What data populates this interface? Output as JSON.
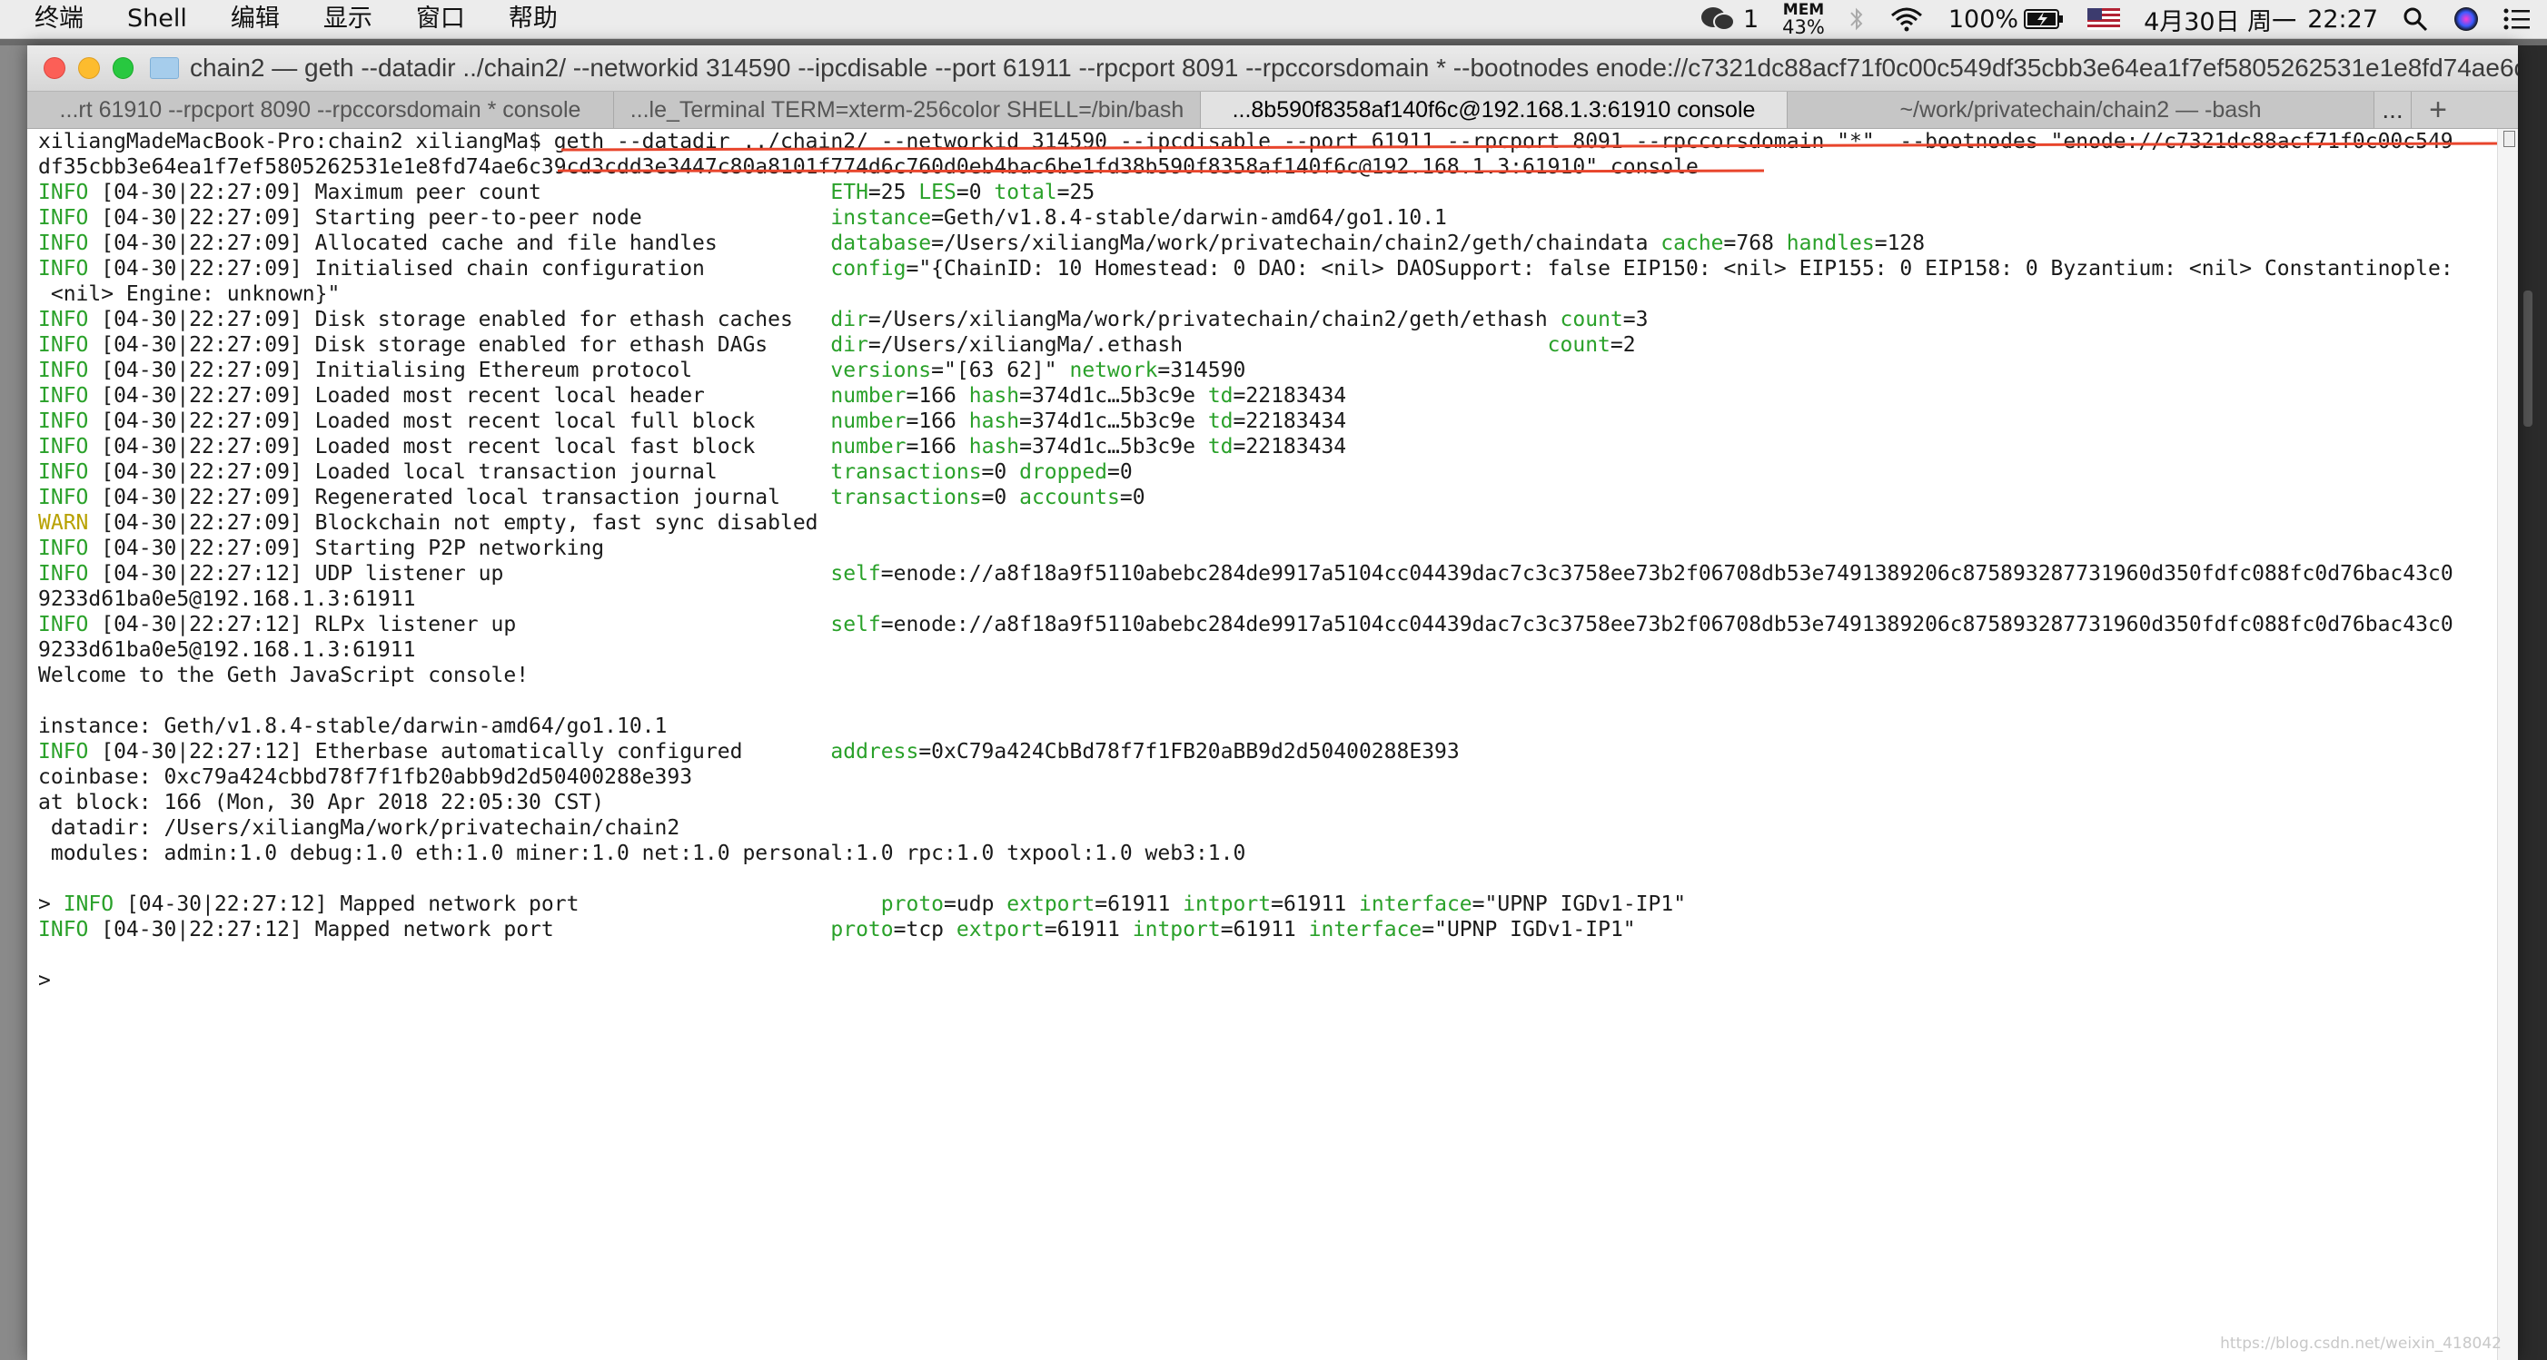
{
  "menubar": {
    "items": [
      "终端",
      "Shell",
      "编辑",
      "显示",
      "窗口",
      "帮助"
    ],
    "status": {
      "wechat_count": "1",
      "mem_label": "MEM",
      "mem_value": "43%",
      "battery": "100%",
      "date": "4月30日 周一",
      "time": "22:27"
    }
  },
  "window": {
    "title": "chain2 — geth --datadir ../chain2/ --networkid 314590 --ipcdisable --port 61911 --rpcport 8091 --rpccorsdomain * --bootnodes enode://c7321dc88acf71f0c00c549df35cbb3e64ea1f7ef5805262531e1e8fd74ae6c...",
    "tabs": [
      "...rt 61910 --rpcport 8090 --rpccorsdomain * console",
      "...le_Terminal TERM=xterm-256color SHELL=/bin/bash",
      "...8b590f8358af140f6c@192.168.1.3:61910 console",
      "~/work/privatechain/chain2 — -bash"
    ],
    "tab_more": "...",
    "tab_add": "+"
  },
  "terminal": {
    "lines": [
      [
        {
          "t": "xiliangMadeMacBook-Pro:chain2 xiliangMa$ geth --datadir ../chain2/ --networkid 314590 --ipcdisable --port 61911 --rpcport 8091 --rpccorsdomain \"*\"  --bootnodes \"enode://c7321dc88acf71f0c00c549"
        }
      ],
      [
        {
          "t": "df35cbb3e64ea1f7ef5805262531e1e8fd74ae6c39cd3cdd3e3447c80a8101f774d6c760d0eb4bac6be1fd38b590f8358af140f6c@192.168.1.3:61910\" console"
        }
      ],
      [
        {
          "t": "INFO",
          "c": "g"
        },
        {
          "t": " [04-30|22:27:09] Maximum peer count                       "
        },
        {
          "t": "ETH",
          "c": "g"
        },
        {
          "t": "=25 "
        },
        {
          "t": "LES",
          "c": "g"
        },
        {
          "t": "=0 "
        },
        {
          "t": "total",
          "c": "g"
        },
        {
          "t": "=25"
        }
      ],
      [
        {
          "t": "INFO",
          "c": "g"
        },
        {
          "t": " [04-30|22:27:09] Starting peer-to-peer node               "
        },
        {
          "t": "instance",
          "c": "g"
        },
        {
          "t": "=Geth/v1.8.4-stable/darwin-amd64/go1.10.1"
        }
      ],
      [
        {
          "t": "INFO",
          "c": "g"
        },
        {
          "t": " [04-30|22:27:09] Allocated cache and file handles         "
        },
        {
          "t": "database",
          "c": "g"
        },
        {
          "t": "=/Users/xiliangMa/work/privatechain/chain2/geth/chaindata "
        },
        {
          "t": "cache",
          "c": "g"
        },
        {
          "t": "=768 "
        },
        {
          "t": "handles",
          "c": "g"
        },
        {
          "t": "=128"
        }
      ],
      [
        {
          "t": "INFO",
          "c": "g"
        },
        {
          "t": " [04-30|22:27:09] Initialised chain configuration          "
        },
        {
          "t": "config",
          "c": "g"
        },
        {
          "t": "=\"{ChainID: 10 Homestead: 0 DAO: <nil> DAOSupport: false EIP150: <nil> EIP155: 0 EIP158: 0 Byzantium: <nil> Constantinople:"
        }
      ],
      [
        {
          "t": " <nil> Engine: unknown}\""
        }
      ],
      [
        {
          "t": "INFO",
          "c": "g"
        },
        {
          "t": " [04-30|22:27:09] Disk storage enabled for ethash caches   "
        },
        {
          "t": "dir",
          "c": "g"
        },
        {
          "t": "=/Users/xiliangMa/work/privatechain/chain2/geth/ethash "
        },
        {
          "t": "count",
          "c": "g"
        },
        {
          "t": "=3"
        }
      ],
      [
        {
          "t": "INFO",
          "c": "g"
        },
        {
          "t": " [04-30|22:27:09] Disk storage enabled for ethash DAGs     "
        },
        {
          "t": "dir",
          "c": "g"
        },
        {
          "t": "=/Users/xiliangMa/.ethash                             "
        },
        {
          "t": "count",
          "c": "g"
        },
        {
          "t": "=2"
        }
      ],
      [
        {
          "t": "INFO",
          "c": "g"
        },
        {
          "t": " [04-30|22:27:09] Initialising Ethereum protocol           "
        },
        {
          "t": "versions",
          "c": "g"
        },
        {
          "t": "=\"[63 62]\" "
        },
        {
          "t": "network",
          "c": "g"
        },
        {
          "t": "=314590"
        }
      ],
      [
        {
          "t": "INFO",
          "c": "g"
        },
        {
          "t": " [04-30|22:27:09] Loaded most recent local header          "
        },
        {
          "t": "number",
          "c": "g"
        },
        {
          "t": "=166 "
        },
        {
          "t": "hash",
          "c": "g"
        },
        {
          "t": "=374d1c…5b3c9e "
        },
        {
          "t": "td",
          "c": "g"
        },
        {
          "t": "=22183434"
        }
      ],
      [
        {
          "t": "INFO",
          "c": "g"
        },
        {
          "t": " [04-30|22:27:09] Loaded most recent local full block      "
        },
        {
          "t": "number",
          "c": "g"
        },
        {
          "t": "=166 "
        },
        {
          "t": "hash",
          "c": "g"
        },
        {
          "t": "=374d1c…5b3c9e "
        },
        {
          "t": "td",
          "c": "g"
        },
        {
          "t": "=22183434"
        }
      ],
      [
        {
          "t": "INFO",
          "c": "g"
        },
        {
          "t": " [04-30|22:27:09] Loaded most recent local fast block      "
        },
        {
          "t": "number",
          "c": "g"
        },
        {
          "t": "=166 "
        },
        {
          "t": "hash",
          "c": "g"
        },
        {
          "t": "=374d1c…5b3c9e "
        },
        {
          "t": "td",
          "c": "g"
        },
        {
          "t": "=22183434"
        }
      ],
      [
        {
          "t": "INFO",
          "c": "g"
        },
        {
          "t": " [04-30|22:27:09] Loaded local transaction journal         "
        },
        {
          "t": "transactions",
          "c": "g"
        },
        {
          "t": "=0 "
        },
        {
          "t": "dropped",
          "c": "g"
        },
        {
          "t": "=0"
        }
      ],
      [
        {
          "t": "INFO",
          "c": "g"
        },
        {
          "t": " [04-30|22:27:09] Regenerated local transaction journal    "
        },
        {
          "t": "transactions",
          "c": "g"
        },
        {
          "t": "=0 "
        },
        {
          "t": "accounts",
          "c": "g"
        },
        {
          "t": "=0"
        }
      ],
      [
        {
          "t": "WARN",
          "c": "y"
        },
        {
          "t": " [04-30|22:27:09] Blockchain not empty, fast sync disabled"
        }
      ],
      [
        {
          "t": "INFO",
          "c": "g"
        },
        {
          "t": " [04-30|22:27:09] Starting P2P networking"
        }
      ],
      [
        {
          "t": "INFO",
          "c": "g"
        },
        {
          "t": " [04-30|22:27:12] UDP listener up                          "
        },
        {
          "t": "self",
          "c": "g"
        },
        {
          "t": "=enode://a8f18a9f5110abebc284de9917a5104cc04439dac7c3c3758ee73b2f06708db53e7491389206c875893287731960d350fdfc088fc0d76bac43c0"
        }
      ],
      [
        {
          "t": "9233d61ba0e5@192.168.1.3:61911"
        }
      ],
      [
        {
          "t": "INFO",
          "c": "g"
        },
        {
          "t": " [04-30|22:27:12] RLPx listener up                         "
        },
        {
          "t": "self",
          "c": "g"
        },
        {
          "t": "=enode://a8f18a9f5110abebc284de9917a5104cc04439dac7c3c3758ee73b2f06708db53e7491389206c875893287731960d350fdfc088fc0d76bac43c0"
        }
      ],
      [
        {
          "t": "9233d61ba0e5@192.168.1.3:61911"
        }
      ],
      [
        {
          "t": "Welcome to the Geth JavaScript console!"
        }
      ],
      [
        {
          "t": ""
        }
      ],
      [
        {
          "t": "instance: Geth/v1.8.4-stable/darwin-amd64/go1.10.1"
        }
      ],
      [
        {
          "t": "INFO",
          "c": "g"
        },
        {
          "t": " [04-30|22:27:12] Etherbase automatically configured       "
        },
        {
          "t": "address",
          "c": "g"
        },
        {
          "t": "=0xC79a424CbBd78f7f1FB20aBB9d2d50400288E393"
        }
      ],
      [
        {
          "t": "coinbase: 0xc79a424cbbd78f7f1fb20abb9d2d50400288e393"
        }
      ],
      [
        {
          "t": "at block: 166 (Mon, 30 Apr 2018 22:05:30 CST)"
        }
      ],
      [
        {
          "t": " datadir: /Users/xiliangMa/work/privatechain/chain2"
        }
      ],
      [
        {
          "t": " modules: admin:1.0 debug:1.0 eth:1.0 miner:1.0 net:1.0 personal:1.0 rpc:1.0 txpool:1.0 web3:1.0"
        }
      ],
      [
        {
          "t": ""
        }
      ],
      [
        {
          "t": "> "
        },
        {
          "t": "INFO",
          "c": "g"
        },
        {
          "t": " [04-30|22:27:12] Mapped network port                        "
        },
        {
          "t": "proto",
          "c": "g"
        },
        {
          "t": "=udp "
        },
        {
          "t": "extport",
          "c": "g"
        },
        {
          "t": "=61911 "
        },
        {
          "t": "intport",
          "c": "g"
        },
        {
          "t": "=61911 "
        },
        {
          "t": "interface",
          "c": "g"
        },
        {
          "t": "=\"UPNP IGDv1-IP1\""
        }
      ],
      [
        {
          "t": "INFO",
          "c": "g"
        },
        {
          "t": " [04-30|22:27:12] Mapped network port                      "
        },
        {
          "t": "proto",
          "c": "g"
        },
        {
          "t": "=tcp "
        },
        {
          "t": "extport",
          "c": "g"
        },
        {
          "t": "=61911 "
        },
        {
          "t": "intport",
          "c": "g"
        },
        {
          "t": "=61911 "
        },
        {
          "t": "interface",
          "c": "g"
        },
        {
          "t": "=\"UPNP IGDv1-IP1\""
        }
      ],
      [
        {
          "t": ""
        }
      ],
      [
        {
          "t": "> "
        }
      ]
    ],
    "prompt_cursor_line": 34,
    "colors": {
      "key": "#2aa12a",
      "warn": "#b8a100",
      "highlight": "#e8452c"
    }
  },
  "watermark": "https://blog.csdn.net/weixin_418042"
}
